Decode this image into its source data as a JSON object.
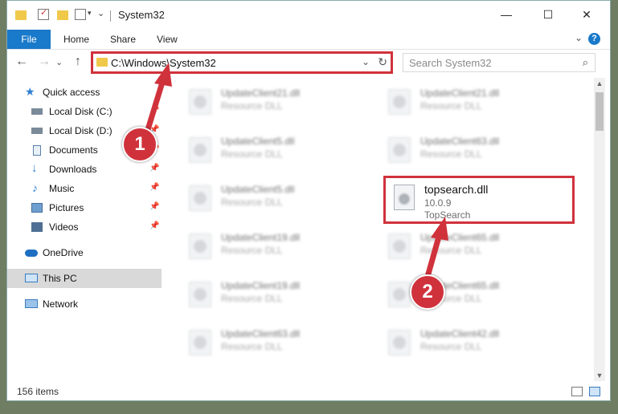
{
  "window": {
    "title": "System32"
  },
  "ribbon": {
    "tabs": [
      {
        "label": "File"
      },
      {
        "label": "Home"
      },
      {
        "label": "Share"
      },
      {
        "label": "View"
      }
    ]
  },
  "address_bar": {
    "path": "C:\\Windows\\System32"
  },
  "search": {
    "placeholder": "Search System32"
  },
  "sidebar": {
    "items": [
      {
        "label": "Quick access",
        "icon": "star-icon",
        "pinned": false
      },
      {
        "label": "Local Disk (C:)",
        "icon": "drive-icon",
        "pinned": true
      },
      {
        "label": "Local Disk (D:)",
        "icon": "drive-icon",
        "pinned": true
      },
      {
        "label": "Documents",
        "icon": "documents-icon",
        "pinned": true
      },
      {
        "label": "Downloads",
        "icon": "download-icon",
        "pinned": true
      },
      {
        "label": "Music",
        "icon": "music-icon",
        "pinned": true
      },
      {
        "label": "Pictures",
        "icon": "pictures-icon",
        "pinned": true
      },
      {
        "label": "Videos",
        "icon": "videos-icon",
        "pinned": true
      },
      {
        "label": "OneDrive",
        "icon": "cloud-icon",
        "pinned": false
      },
      {
        "label": "This PC",
        "icon": "computer-icon",
        "pinned": false,
        "selected": true
      },
      {
        "label": "Network",
        "icon": "network-icon",
        "pinned": false
      }
    ]
  },
  "files": [
    {
      "name": "UpdateClient21.dll",
      "type": "Resource DLL"
    },
    {
      "name": "UpdateClient21.dll",
      "type": "Resource DLL"
    },
    {
      "name": "UpdateClient5.dll",
      "type": "Resource DLL"
    },
    {
      "name": "UpdateClient63.dll",
      "type": "Resource DLL"
    },
    {
      "name": "UpdateClient5.dll",
      "type": "Resource DLL"
    },
    {
      "name": "UpdateClient19.dll",
      "type": "Resource DLL"
    },
    {
      "name": "UpdateClient65.dll",
      "type": "Resource DLL"
    },
    {
      "name": "UpdateClient19.dll",
      "type": "Resource DLL"
    },
    {
      "name": "UpdateClient65.dll",
      "type": "Resource DLL"
    },
    {
      "name": "UpdateClient63.dll",
      "type": "Resource DLL"
    },
    {
      "name": "UpdateClient42.dll",
      "type": "Resource DLL"
    }
  ],
  "selected_file": {
    "name": "topsearch.dll",
    "version": "10.0.9",
    "description": "TopSearch"
  },
  "status": {
    "item_count": "156 items"
  },
  "callouts": [
    {
      "number": "1"
    },
    {
      "number": "2"
    }
  ],
  "colors": {
    "accent": "#1979ca",
    "highlight": "#d0323c"
  }
}
